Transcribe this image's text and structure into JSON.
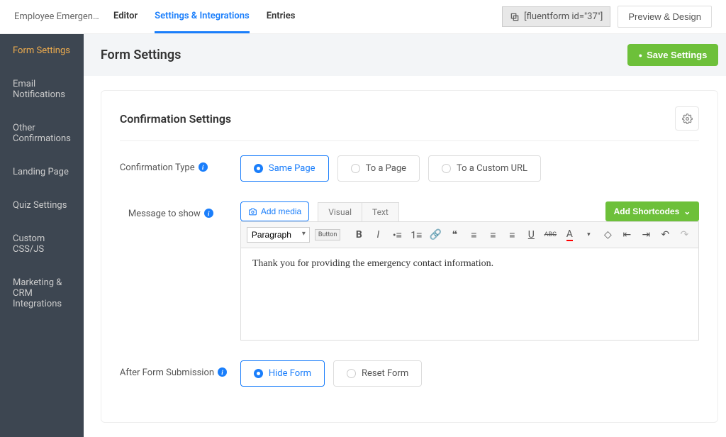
{
  "form_title": "Employee Emergenc...",
  "top_tabs": {
    "editor": "Editor",
    "settings": "Settings & Integrations",
    "entries": "Entries"
  },
  "shortcode": "[fluentform id=\"37\"]",
  "preview_btn": "Preview & Design",
  "sidebar": {
    "items": [
      "Form Settings",
      "Email Notifications",
      "Other Confirmations",
      "Landing Page",
      "Quiz Settings",
      "Custom CSS/JS",
      "Marketing & CRM Integrations"
    ]
  },
  "page_title": "Form Settings",
  "save_btn": "Save Settings",
  "section_title": "Confirmation Settings",
  "labels": {
    "confirmation_type": "Confirmation Type",
    "message_to_show": "Message to show",
    "after_submission": "After Form Submission"
  },
  "confirmation_options": {
    "same_page": "Same Page",
    "to_page": "To a Page",
    "to_url": "To a Custom URL"
  },
  "editor": {
    "add_media": "Add media",
    "tab_visual": "Visual",
    "tab_text": "Text",
    "add_shortcodes": "Add Shortcodes",
    "paragraph": "Paragraph",
    "button_label": "Button",
    "content": "Thank you for providing the emergency contact information."
  },
  "after_options": {
    "hide": "Hide Form",
    "reset": "Reset Form"
  }
}
